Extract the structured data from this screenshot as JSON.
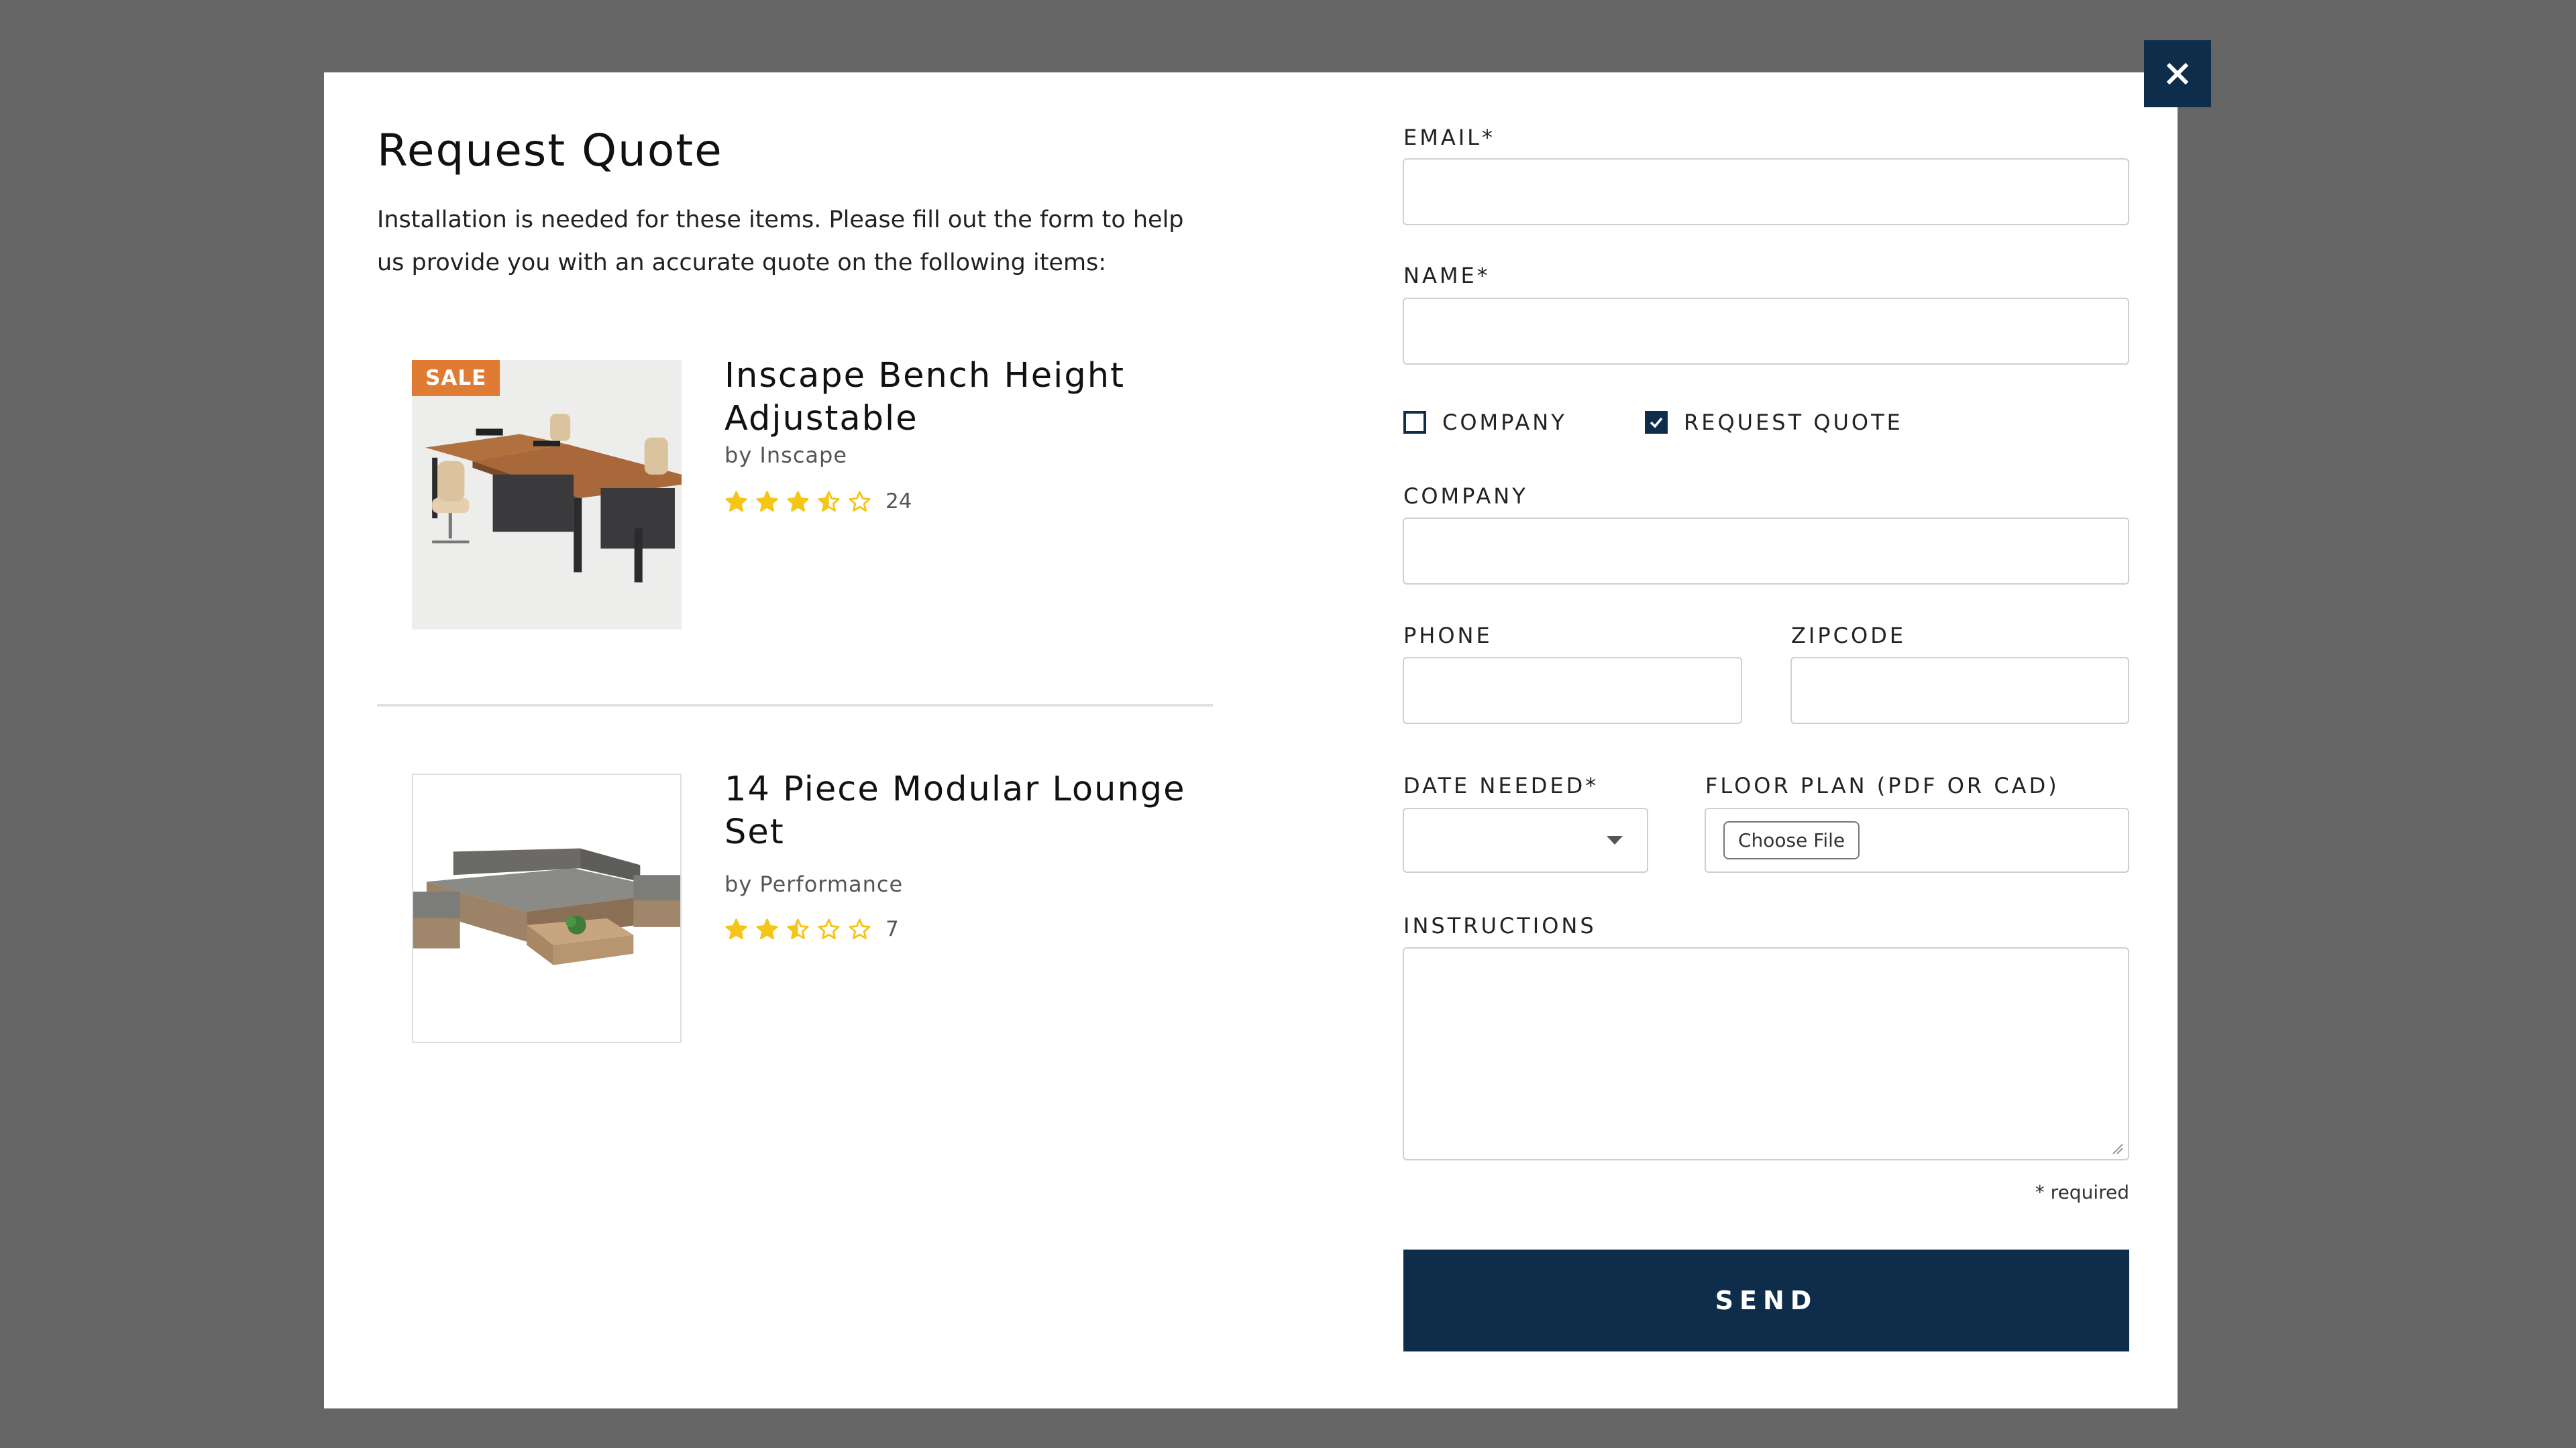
{
  "modal": {
    "title": "Request Quote",
    "intro": "Installation is needed for these items. Please fill out the form to help us provide you with an accurate quote on the following items:",
    "close_label": "×"
  },
  "products": [
    {
      "name": "Inscape Bench Height Adjustable",
      "brand": "by Inscape",
      "badge": "SALE",
      "rating": 3.5,
      "review_count": "24"
    },
    {
      "name": "14 Piece Modular Lounge Set",
      "brand": "by Performance",
      "rating": 2.5,
      "review_count": "7"
    }
  ],
  "form": {
    "email_label": "EMAIL*",
    "email_value": "",
    "name_label": "NAME*",
    "name_value": "",
    "company_checkbox_label": "COMPANY",
    "company_checked": false,
    "request_quote_checkbox_label": "REQUEST QUOTE",
    "request_quote_checked": true,
    "company_label": "COMPANY",
    "company_value": "",
    "phone_label": "PHONE",
    "phone_value": "",
    "zipcode_label": "ZIPCODE",
    "zipcode_value": "",
    "date_label": "DATE NEEDED*",
    "date_value": "",
    "floor_plan_label": "FLOOR PLAN (PDF OR CAD)",
    "choose_file_label": "Choose File",
    "instructions_label": "INSTRUCTIONS",
    "instructions_value": "",
    "required_note": "* required",
    "send_label": "SEND"
  },
  "colors": {
    "overlay": "#666666",
    "primary": "#0d2d4a",
    "sale": "#e07b33",
    "star": "#f5c518"
  }
}
